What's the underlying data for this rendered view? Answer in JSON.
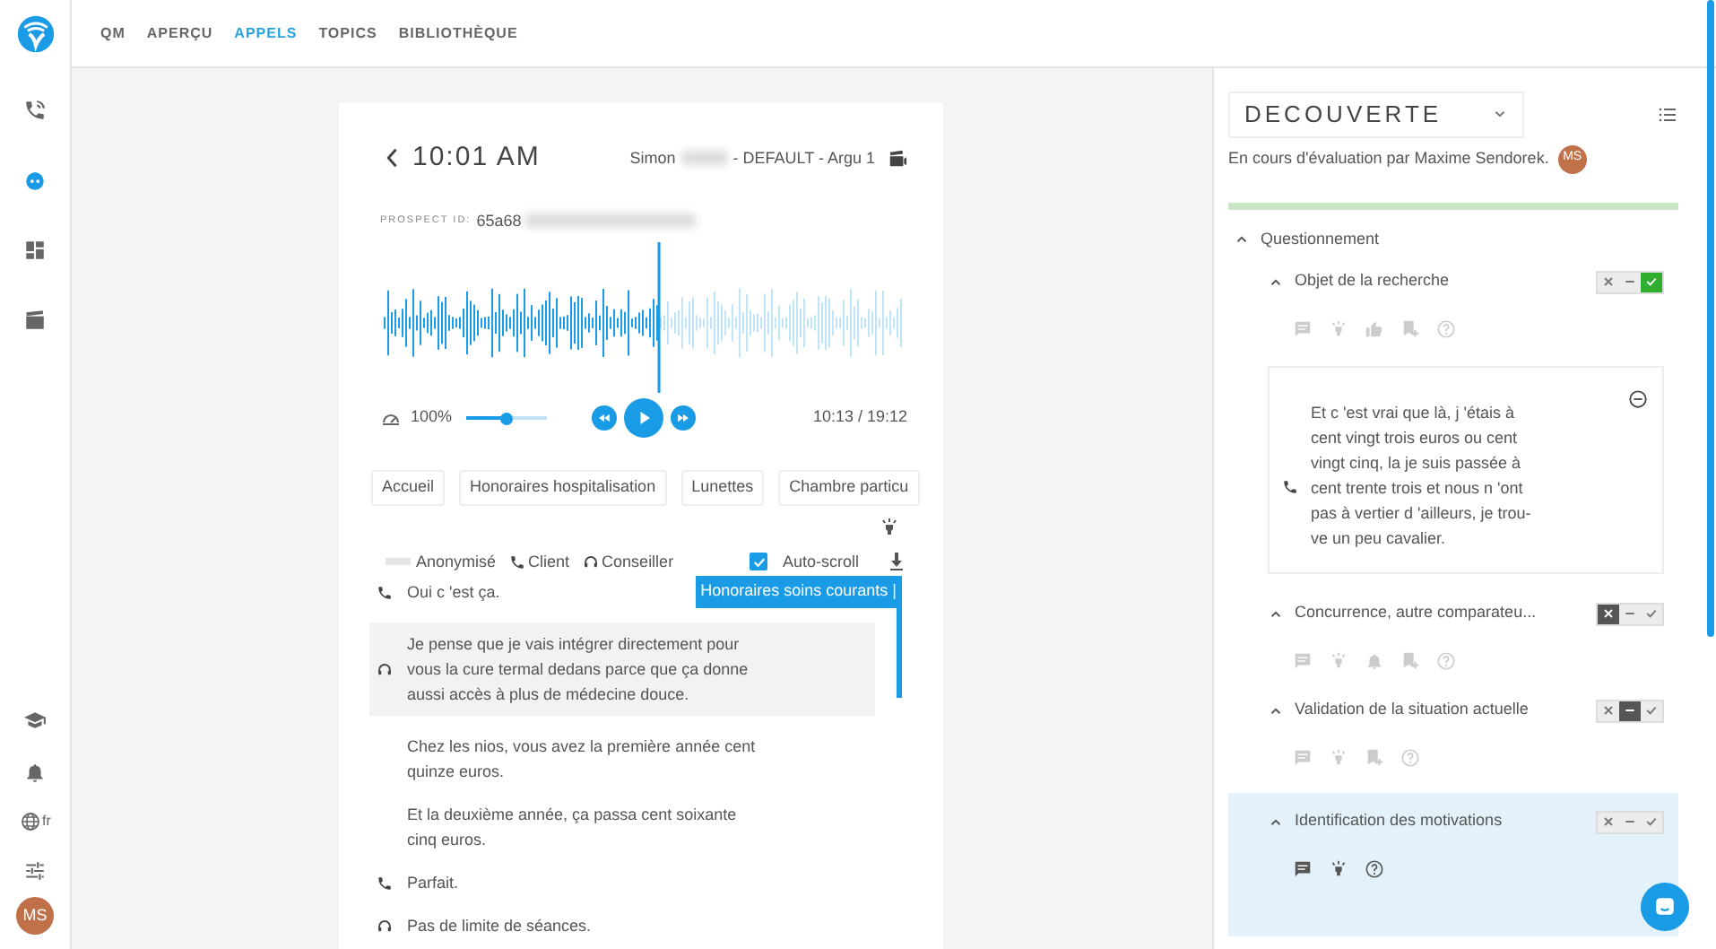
{
  "nav": {
    "tabs": [
      {
        "label": "QM",
        "selected": false
      },
      {
        "label": "APERÇU",
        "selected": false
      },
      {
        "label": "APPELS",
        "selected": true
      },
      {
        "label": "TOPICS",
        "selected": false
      },
      {
        "label": "BIBLIOTHÈQUE",
        "selected": false
      }
    ]
  },
  "sidebar": {
    "top": [
      {
        "kind": "calls",
        "selected": false
      },
      {
        "kind": "assistant",
        "selected": true
      },
      {
        "kind": "dashboard",
        "selected": false
      },
      {
        "kind": "library",
        "selected": false
      }
    ],
    "bottom": [
      {
        "kind": "training"
      },
      {
        "kind": "notifications"
      },
      {
        "kind": "language",
        "label": "fr"
      },
      {
        "kind": "settings"
      }
    ],
    "avatar": "MS"
  },
  "call": {
    "time": "10:01 AM",
    "agent": "Simon",
    "campaign": "- DEFAULT - Argu 1",
    "prospect_label": "PROSPECT ID:",
    "prospect_id": "65a68"
  },
  "player": {
    "position": {
      "level": 0.53
    },
    "speed": "100%",
    "speed_slider": {
      "level": 0.5
    },
    "time": "10:13 / 19:12"
  },
  "topics": [
    "Accueil",
    "Honoraires hospitalisation",
    "Lunettes",
    "Chambre particu"
  ],
  "legend": {
    "anonymized": "Anonymisé",
    "client": "Client",
    "advisor": "Conseiller",
    "autoscroll": {
      "label": "Auto-scroll",
      "checked": true
    }
  },
  "topic_tag": "Honoraires soins courants |",
  "transcript": [
    {
      "kind": "client",
      "text": "Oui c 'est ça.",
      "highlighted": false
    },
    {
      "kind": "advisor",
      "text": "Je pense que je vais intégrer directement pour vous la cure termal dedans parce que ça donne aussi accès à plus de médecine douce.",
      "highlighted": true
    },
    {
      "kind": "continuation",
      "text": "Chez les nios, vous avez la première année cent quinze euros.",
      "highlighted": false
    },
    {
      "kind": "continuation",
      "text": "Et la deuxième année, ça passa cent soixante cinq euros.",
      "highlighted": false
    },
    {
      "kind": "client",
      "text": "Parfait.",
      "highlighted": false
    },
    {
      "kind": "advisor",
      "text": "Pas de limite de séances.",
      "highlighted": false
    }
  ],
  "evaluation": {
    "section": "DECOUVERTE",
    "status": "En cours d'évaluation par Maxime Sendorek.",
    "avatar": "MS",
    "progress": {
      "level": 1.0
    },
    "group": {
      "title": "Questionnement",
      "expanded": true,
      "children": [
        {
          "title": "Objet de la recherche",
          "expanded": true,
          "selected": false,
          "rating": [
            {
              "kind": "no",
              "selected": false
            },
            {
              "kind": "neutral",
              "selected": false
            },
            {
              "kind": "yes",
              "selected": true
            }
          ],
          "actions": [
            {
              "kind": "comment"
            },
            {
              "kind": "insight"
            },
            {
              "kind": "thumb"
            },
            {
              "kind": "bookmark"
            },
            {
              "kind": "help"
            }
          ],
          "excerpt": {
            "kind": "client",
            "text": "Et c 'est vrai que là, j 'étais à cent vingt trois euros ou cent vingt cinq, la je suis passée à cent trente trois et nous n 'ont pas à vertier d 'ailleurs, je trou-ve un peu cavalier."
          }
        },
        {
          "title": "Concurrence, autre comparateu...",
          "expanded": true,
          "selected": false,
          "rating": [
            {
              "kind": "no",
              "selected": true
            },
            {
              "kind": "neutral",
              "selected": false
            },
            {
              "kind": "yes",
              "selected": false
            }
          ],
          "actions": [
            {
              "kind": "comment"
            },
            {
              "kind": "insight"
            },
            {
              "kind": "bell"
            },
            {
              "kind": "bookmark"
            },
            {
              "kind": "help"
            }
          ]
        },
        {
          "title": "Validation de la situation actuelle",
          "expanded": true,
          "selected": false,
          "rating": [
            {
              "kind": "no",
              "selected": false
            },
            {
              "kind": "neutral",
              "selected": true
            },
            {
              "kind": "yes",
              "selected": false
            }
          ],
          "actions": [
            {
              "kind": "comment"
            },
            {
              "kind": "insight"
            },
            {
              "kind": "bookmark"
            },
            {
              "kind": "help"
            }
          ]
        },
        {
          "title": "Identification des motivations",
          "expanded": true,
          "selected": true,
          "rating": [
            {
              "kind": "no",
              "selected": false
            },
            {
              "kind": "neutral",
              "selected": false
            },
            {
              "kind": "yes",
              "selected": false
            }
          ],
          "actions": [
            {
              "kind": "comment"
            },
            {
              "kind": "insight"
            },
            {
              "kind": "help"
            }
          ]
        }
      ]
    }
  }
}
